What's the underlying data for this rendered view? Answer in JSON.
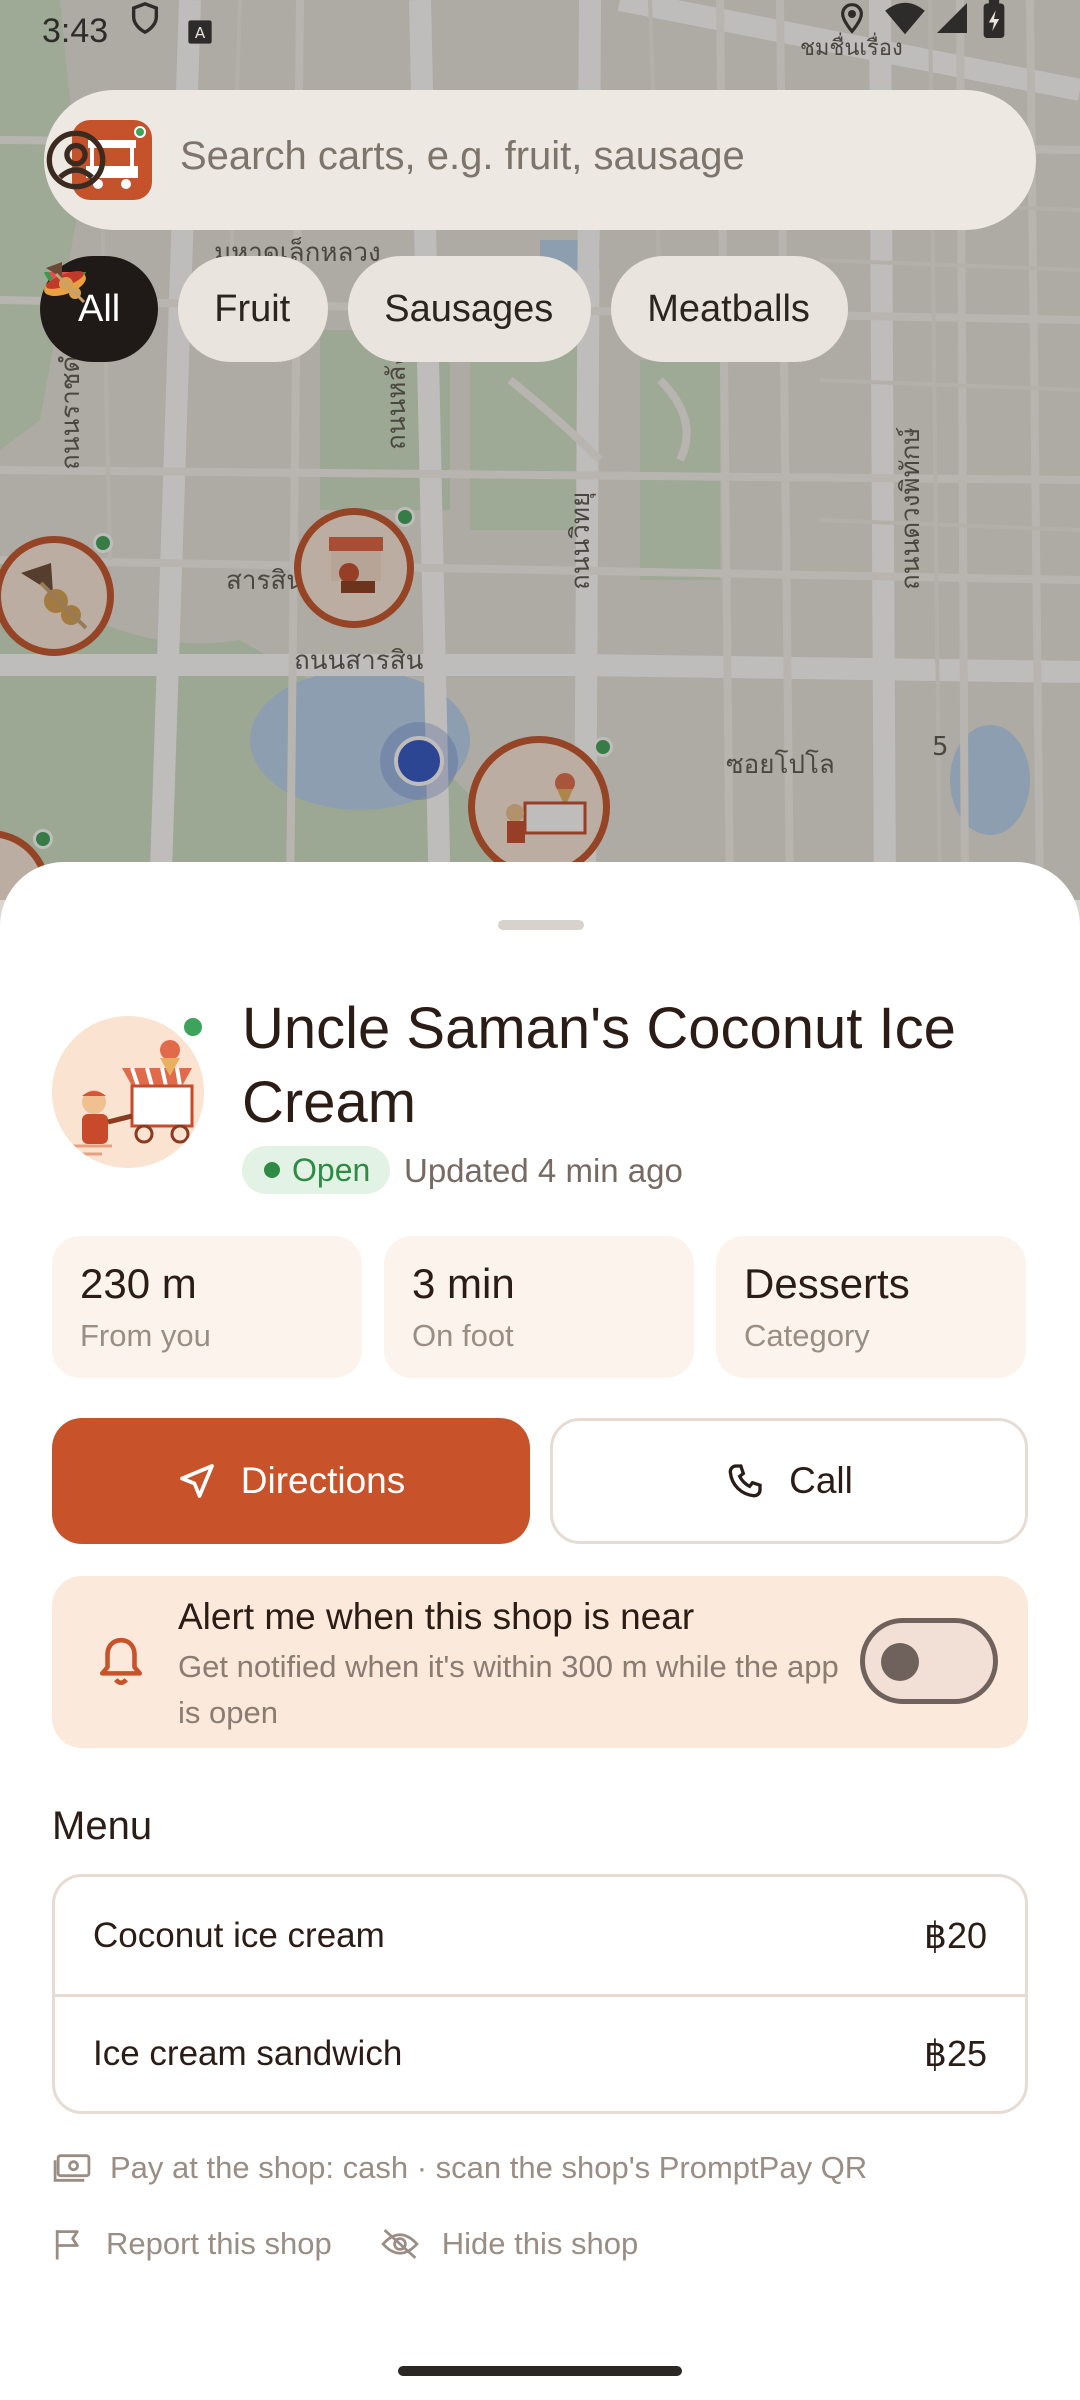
{
  "status_bar": {
    "time": "3:43"
  },
  "search": {
    "placeholder": "Search carts, e.g. fruit, sausage"
  },
  "chips": [
    {
      "label": "All",
      "icon": "none"
    },
    {
      "label": "Fruit",
      "icon": "watermelon-icon"
    },
    {
      "label": "Sausages",
      "icon": "hotdog-icon"
    },
    {
      "label": "Meatballs",
      "icon": "skewer-icon"
    }
  ],
  "map_labels": {
    "a": "มหาดเล็กหลวง",
    "b": "ถนนราชดำริ",
    "c": "ถนนหลังสวน",
    "d": "ถนนสารสิน",
    "e": "ถนนวิทยุ",
    "f": "ซอยโปโล",
    "g": "ถนนดวงพิทักษ์",
    "h": "ชมชื่นเรื่อง",
    "i": "5",
    "j": "สารสิน"
  },
  "shop": {
    "name": "Uncle Saman's Coconut Ice Cream",
    "status": "Open",
    "updated": "Updated 4 min ago",
    "stats": [
      {
        "value": "230 m",
        "label": "From you"
      },
      {
        "value": "3 min",
        "label": "On foot"
      },
      {
        "value": "Desserts",
        "label": "Category"
      }
    ],
    "directions_label": "Directions",
    "call_label": "Call",
    "alert": {
      "title": "Alert me when this shop is near",
      "subtitle": "Get notified when it's within 300 m while the app is open",
      "enabled": false
    },
    "menu_heading": "Menu",
    "menu": [
      {
        "item": "Coconut ice cream",
        "price": "฿20"
      },
      {
        "item": "Ice cream sandwich",
        "price": "฿25"
      }
    ],
    "payment": "Pay at the shop: cash · scan the shop's PromptPay QR",
    "report_label": "Report this shop",
    "hide_label": "Hide this shop"
  },
  "colors": {
    "accent": "#c8532a",
    "open_green": "#2e8b45",
    "alert_bg": "#fbeadb"
  }
}
